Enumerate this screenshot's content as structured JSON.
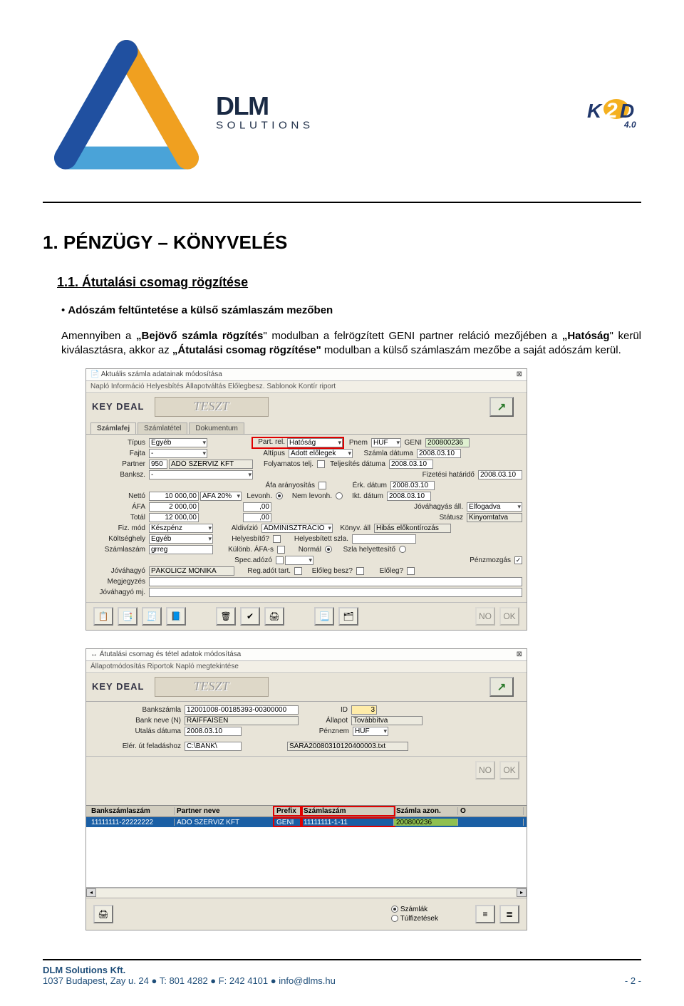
{
  "header": {
    "left_logo_alt": "DLM Solutions",
    "right_logo_alt": "K2D 4.0",
    "right_logo_version": "4.0"
  },
  "content": {
    "h1": "1. PÉNZÜGY – KÖNYVELÉS",
    "h2": "1.1. Átutalási csomag rögzítése",
    "bullet": "Adószám feltűntetése a külső számlaszám mezőben",
    "para_prefix": "Amennyiben a ",
    "para_b1": "„Bejövő számla rögzítés",
    "para_mid1": "\" modulban a felrögzített GENI partner reláció mezőjében a ",
    "para_b2": "„Hatóság",
    "para_mid2": "\" kerül kiválasztásra, akkor az ",
    "para_b3": "„Átutalási csomag rögzítése\"",
    "para_suffix": " modulban a külső számlaszám mezőbe a saját adószám kerül."
  },
  "ss1": {
    "title": "Aktuális számla adatainak módosítása",
    "menu": "Napló   Információ   Helyesbítés   Állapotváltás   Előlegbesz.   Sablonok   Kontír riport",
    "logo_text": "KEY   DEAL",
    "teszt": "TESZT",
    "tabs": [
      "Számlafej",
      "Számlatétel",
      "Dokumentum"
    ],
    "rows": {
      "tipus_lbl": "Típus",
      "tipus_val": "Egyéb",
      "partrel_lbl": "Part. rel.",
      "partrel_val": "Hatóság",
      "pnem_lbl": "Pnem",
      "pnem_val": "HUF",
      "geni_lbl": "GENI",
      "geni_val": "200800236",
      "fajta_lbl": "Fajta",
      "fajta_val": "-",
      "altipus_lbl": "Altípus",
      "altipus_val": "Adott előlegek",
      "szamladat_lbl": "Számla dátuma",
      "szamladat_val": "2008.03.10",
      "partner_lbl": "Partner",
      "partner_id": "950",
      "partner_name": "ADÓ SZERVIZ KFT",
      "folyt_lbl": "Folyamatos telj.",
      "teljdat_lbl": "Teljesítés dátuma",
      "teljdat_val": "2008.03.10",
      "banksz_lbl": "Banksz.",
      "banksz_val": "-",
      "fizhat_lbl": "Fizetési határidő",
      "fizhat_val": "2008.03.10",
      "afaar_lbl": "Áfa arányosítás",
      "erkdat_lbl": "Érk. dátum",
      "erkdat_val": "2008.03.10",
      "netto_lbl": "Nettó",
      "netto_val": "10 000,00",
      "afasel_val": "ÁFA 20%",
      "levonh_lbl": "Levonh.",
      "nemlevonh_lbl": "Nem levonh.",
      "iktdat_lbl": "Ikt. dátum",
      "iktdat_val": "2008.03.10",
      "afa_lbl": "ÁFA",
      "afa_val": "2 000,00",
      "afa2_val": ",00",
      "jovall_lbl": "Jóváhagyás áll.",
      "jovall_val": "Elfogadva",
      "total_lbl": "Totál",
      "total_val": "12 000,00",
      "total2_val": ",00",
      "statusz_lbl": "Státusz",
      "statusz_val": "Kinyomtatva",
      "fizmod_lbl": "Fiz. mód",
      "fizmod_val": "Készpénz",
      "aldiv_lbl": "Aldivízió",
      "aldiv_val": "ADMINISZTRÁCIÓ",
      "konyvall_lbl": "Könyv. áll",
      "konyvall_val": "Hibás előkontírozás",
      "koltsh_lbl": "Költséghely",
      "koltsh_val": "Egyéb",
      "helyesbito_lbl": "Helyesbítő?",
      "helyszla_lbl": "Helyesbített szla.",
      "szlaszam_lbl": "Számlaszám",
      "szlaszam_val": "grreg",
      "kulonb_lbl": "Különb. ÁFA-s",
      "normal_lbl": "Normál",
      "szlahely_lbl": "Szla helyettesítő",
      "specadozo_lbl": "Spec.adózó",
      "penzmozg_lbl": "Pénzmozgás",
      "jovahagyo_lbl": "Jóváhagyó",
      "jovahagyo_val": "PÁKOLICZ MÓNIKA",
      "regadot_lbl": "Reg.adót tart.",
      "elolegbesz_lbl": "Előleg besz?",
      "eloleg_lbl": "Előleg?",
      "megj_lbl": "Megjegyzés",
      "jovmj_lbl": "Jóváhagyó mj."
    }
  },
  "ss2": {
    "title": "Átutalási csomag és tétel adatok módosítása",
    "menu": "Állapotmódosítás   Riportok   Napló megtekintése",
    "logo_text": "KEY   DEAL",
    "teszt": "TESZT",
    "banksz_lbl": "Bankszámla",
    "banksz_val": "12001008-00185393-00300000",
    "id_lbl": "ID",
    "id_val": "3",
    "bankn_lbl": "Bank neve (N)",
    "bankn_val": "RAIFFAISEN",
    "allapot_lbl": "Állapot",
    "allapot_val": "Továbbítva",
    "utaldat_lbl": "Utalás dátuma",
    "utaldat_val": "2008.03.10",
    "penznem_lbl": "Pénznem",
    "penznem_val": "HUF",
    "elerut_lbl": "Elér. út feladáshoz",
    "elerut_val": "C:\\BANK\\",
    "elerfile_val": "SARA20080310120400003.txt",
    "grid": {
      "h1": "Bankszámlaszám",
      "h2": "Partner neve",
      "h3": "Prefix",
      "h4": "Számlaszám",
      "h5": "Számla azon.",
      "h6": "Ö",
      "r1": "11111111-22222222",
      "r2": "ADÓ SZERVIZ KFT",
      "r3": "GENI",
      "r4": "11111111-1-11",
      "r5": "200800236"
    },
    "radios": {
      "szamlak": "Számlák",
      "tulfiz": "Túlfizetések"
    }
  },
  "footer": {
    "company": "DLM Solutions Kft.",
    "line2": "1037 Budapest, Zay u. 24 ● T: 801 4282 ● F: 242 4101 ● info@dlms.hu",
    "pagenum": "- 2 -"
  }
}
